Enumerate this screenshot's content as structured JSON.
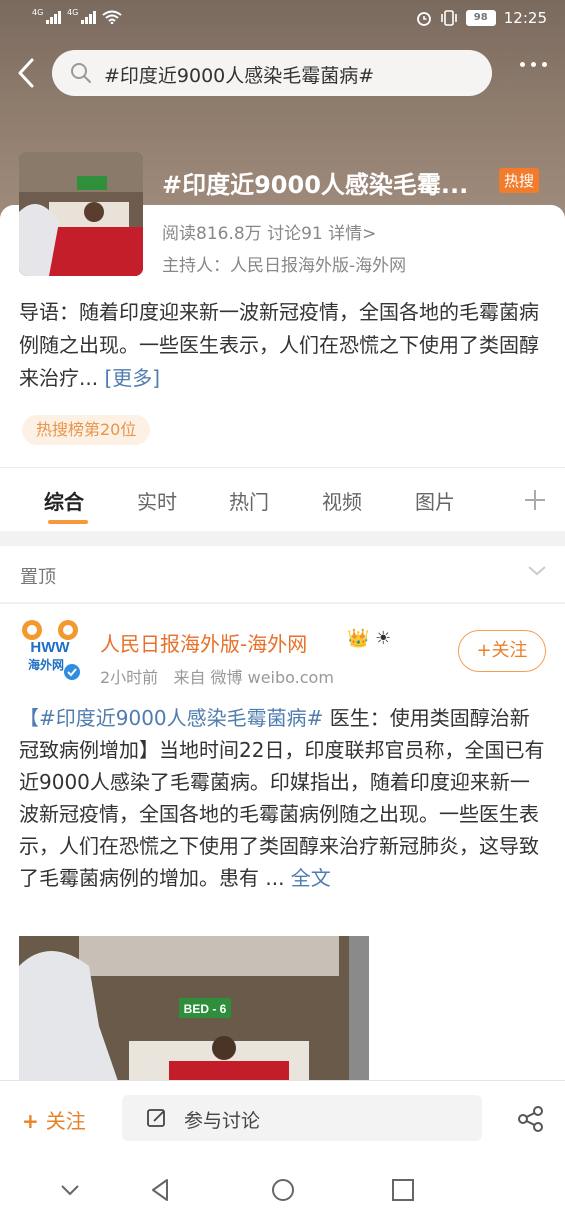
{
  "status": {
    "signal1_tag": "4G",
    "signal2_tag": "4G",
    "battery": "98",
    "time": "12:25"
  },
  "search": {
    "query": "#印度近9000人感染毛霉菌病#"
  },
  "topic": {
    "title": "#印度近9000人感染毛霉...",
    "hot_badge": "热搜",
    "stats": "阅读816.8万  讨论91  详情>",
    "host": "主持人：人民日报海外版-海外网",
    "intro": "导语：随着印度迎来新一波新冠疫情，全国各地的毛霉菌病例随之出现。一些医生表示，人们在恐慌之下使用了类固醇来治疗...",
    "intro_more": "[更多]",
    "rank": "热搜榜第20位"
  },
  "tabs": [
    {
      "label": "综合"
    },
    {
      "label": "实时"
    },
    {
      "label": "热门"
    },
    {
      "label": "视频"
    },
    {
      "label": "图片"
    }
  ],
  "pinned": {
    "label": "置顶"
  },
  "post": {
    "author": "人民日报海外版-海外网",
    "time": "2小时前",
    "source": "来自 微博 weibo.com",
    "follow": "关注",
    "hashtag": "【#印度近9000人感染毛霉菌病#",
    "body": " 医生：使用类固醇治新冠致病例增加】当地时间22日，印度联邦官员称，全国已有近9000人感染了毛霉菌病。印媒指出，随着印度迎来新一波新冠疫情，全国各地的毛霉菌病例随之出现。一些医生表示，人们在恐慌之下使用了类固醇来治疗新冠肺炎，这导致了毛霉菌病例的增加。患有 ... ",
    "full_text": "全文",
    "image_label": "BED - 6",
    "avatar_text": "海外网"
  },
  "bottombar": {
    "follow": "关注",
    "discuss": "参与讨论"
  },
  "colors": {
    "accent_orange": "#e8822a",
    "link_blue": "#507daf",
    "hot_badge": "#f27c2b"
  },
  "icons": [
    "search-icon",
    "back-icon",
    "more-icon",
    "chevron-down-icon",
    "plus-icon",
    "edit-icon",
    "share-icon",
    "nav-down-icon",
    "nav-back-icon",
    "nav-home-icon",
    "nav-recent-icon"
  ]
}
